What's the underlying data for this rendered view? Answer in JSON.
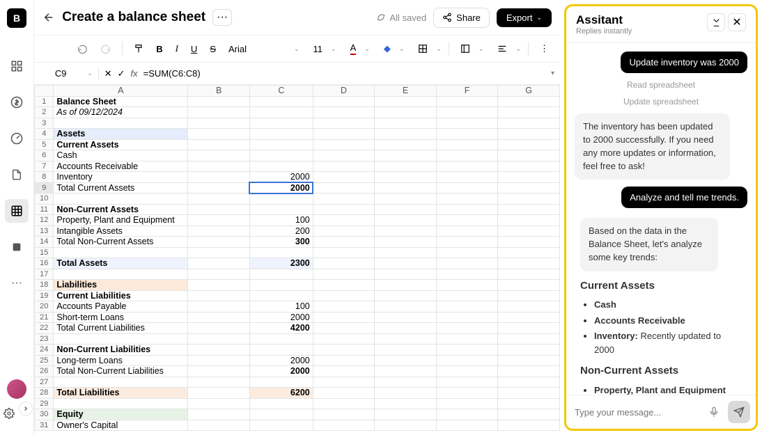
{
  "logo": "B",
  "header": {
    "title": "Create a balance sheet",
    "saved_label": "All saved",
    "share_label": "Share",
    "export_label": "Export"
  },
  "toolbar": {
    "font_name": "Arial",
    "font_size": "11"
  },
  "formula_bar": {
    "cell_ref": "C9",
    "formula": "=SUM(C6:C8)"
  },
  "columns": [
    "A",
    "B",
    "C",
    "D",
    "E",
    "F",
    "G"
  ],
  "rows": [
    {
      "n": 1,
      "a": "Balance Sheet",
      "bold": true
    },
    {
      "n": 2,
      "a": "As of 09/12/2024",
      "italic": true
    },
    {
      "n": 3,
      "a": ""
    },
    {
      "n": 4,
      "a": "Assets",
      "bold": true,
      "style": "hl-blue"
    },
    {
      "n": 5,
      "a": "Current Assets",
      "bold": true
    },
    {
      "n": 6,
      "a": "Cash"
    },
    {
      "n": 7,
      "a": "Accounts Receivable"
    },
    {
      "n": 8,
      "a": "Inventory",
      "c": "2000"
    },
    {
      "n": 9,
      "a": "Total Current Assets",
      "c": "2000",
      "cbold": true,
      "sel": true
    },
    {
      "n": 10,
      "a": ""
    },
    {
      "n": 11,
      "a": "Non-Current Assets",
      "bold": true
    },
    {
      "n": 12,
      "a": "Property, Plant and Equipment",
      "c": "100"
    },
    {
      "n": 13,
      "a": "Intangible Assets",
      "c": "200"
    },
    {
      "n": 14,
      "a": "Total Non-Current Assets",
      "c": "300",
      "cbold": true
    },
    {
      "n": 15,
      "a": ""
    },
    {
      "n": 16,
      "a": "Total Assets",
      "bold": true,
      "style": "hl-lblue",
      "c": "2300",
      "cbold": true,
      "cstyle": "hl-lblue"
    },
    {
      "n": 17,
      "a": ""
    },
    {
      "n": 18,
      "a": "Liabilities",
      "bold": true,
      "style": "hl-orange"
    },
    {
      "n": 19,
      "a": "Current Liabilities",
      "bold": true
    },
    {
      "n": 20,
      "a": "Accounts Payable",
      "c": "100"
    },
    {
      "n": 21,
      "a": "Short-term Loans",
      "c": "2000"
    },
    {
      "n": 22,
      "a": "Total Current Liabilities",
      "c": "4200",
      "cbold": true
    },
    {
      "n": 23,
      "a": ""
    },
    {
      "n": 24,
      "a": "Non-Current Liabilities",
      "bold": true
    },
    {
      "n": 25,
      "a": "Long-term Loans",
      "c": "2000"
    },
    {
      "n": 26,
      "a": "Total Non-Current Liabilities",
      "c": "2000",
      "cbold": true
    },
    {
      "n": 27,
      "a": ""
    },
    {
      "n": 28,
      "a": "Total Liabilities",
      "bold": true,
      "style": "hl-peach",
      "c": "6200",
      "cbold": true,
      "cstyle": "hl-peach"
    },
    {
      "n": 29,
      "a": ""
    },
    {
      "n": 30,
      "a": "Equity",
      "bold": true,
      "style": "hl-green"
    },
    {
      "n": 31,
      "a": "Owner's Capital"
    }
  ],
  "assistant": {
    "title": "Assitant",
    "subtitle": "Replies instantly",
    "placeholder": "Type your message...",
    "messages": {
      "u1": "Update inventory was 2000",
      "s1": "Read spreadsheet",
      "s2": "Update spreadsheet",
      "b1": "The inventory has been updated to 2000 successfully. If you need any more updates or information, feel free to ask!",
      "u2": "Analyze and tell me trends.",
      "b2_intro": "Based on the data in the Balance Sheet, let's analyze some key trends:",
      "h1": "Current Assets",
      "li1": "Cash",
      "li2": "Accounts Receivable",
      "li3a": "Inventory:",
      "li3b": " Recently updated to 2000",
      "h2": "Non-Current Assets",
      "li4": "Property, Plant and Equipment"
    }
  }
}
